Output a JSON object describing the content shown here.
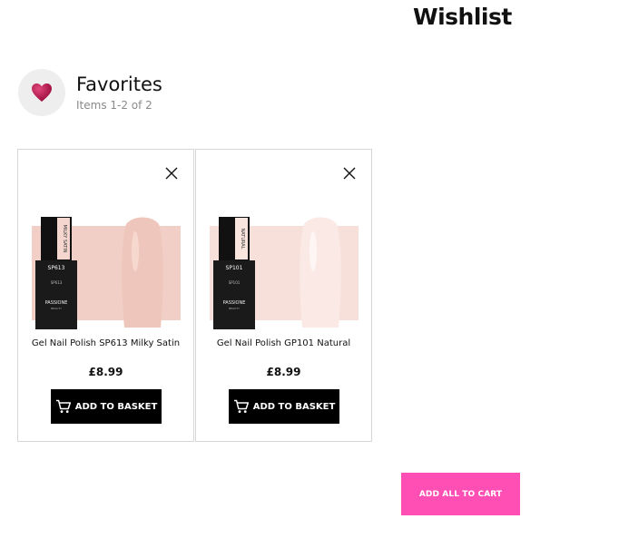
{
  "page": {
    "title": "Wishlist"
  },
  "list": {
    "name": "Favorites",
    "count_text": "Items 1-2 of 2",
    "icon": "heart-icon"
  },
  "products": [
    {
      "name": "Gel Nail Polish SP613 Milky Satin",
      "price": "£8.99",
      "button_label": "ADD TO BASKET",
      "shade_code": "SP613",
      "shade_name": "MILKY SATIN",
      "swatch_color": "#f1cfc6",
      "nail_color": "#efc6bb"
    },
    {
      "name": "Gel Nail Polish GP101 Natural",
      "price": "£8.99",
      "button_label": "ADD TO BASKET",
      "shade_code": "SP101",
      "shade_name": "NATURAL",
      "swatch_color": "#f8e0da",
      "nail_color": "#f6ddd8"
    }
  ],
  "cart": {
    "add_all_label": "ADD ALL TO CART"
  },
  "colors": {
    "accent": "#ff4fb4",
    "button_bg": "#000000",
    "heart": "#b3124f"
  }
}
